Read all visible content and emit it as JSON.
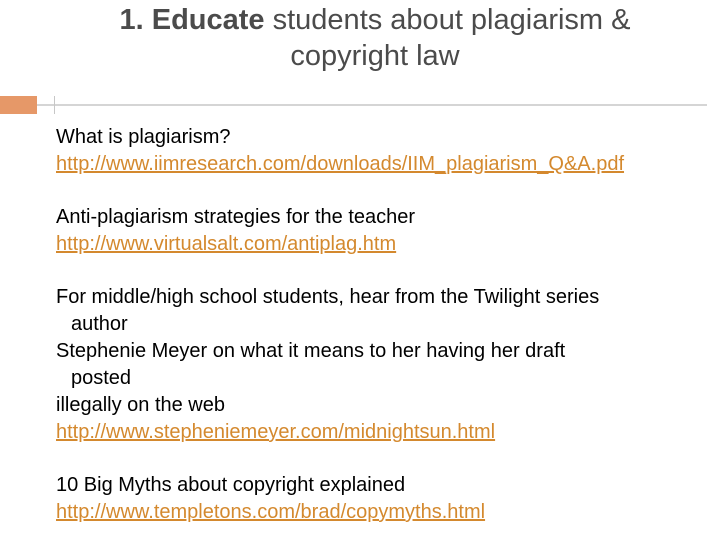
{
  "slide": {
    "title_strong": "1. Educate",
    "title_rest": " students about plagiarism &",
    "title_line2": "copyright law"
  },
  "content": {
    "block1": {
      "text": "What is plagiarism?",
      "link": "http://www.iimresearch.com/downloads/IIM_plagiarism_Q&A.pdf"
    },
    "block2": {
      "text": "Anti-plagiarism strategies for the teacher",
      "link": "http://www.virtualsalt.com/antiplag.htm"
    },
    "block3": {
      "line1": "For middle/high school students, hear from the Twilight series",
      "line2": "author",
      "line3": "Stephenie Meyer on what it means to her having her draft",
      "line4": "posted",
      "line5": "illegally on the web",
      "link": "http://www.stepheniemeyer.com/midnightsun.html"
    },
    "block4": {
      "text": "10 Big Myths about copyright explained",
      "link": "http://www.templetons.com/brad/copymyths.html"
    }
  },
  "colors": {
    "accent": "#e69868",
    "link": "#d4892e",
    "title": "#4b4b4b"
  }
}
